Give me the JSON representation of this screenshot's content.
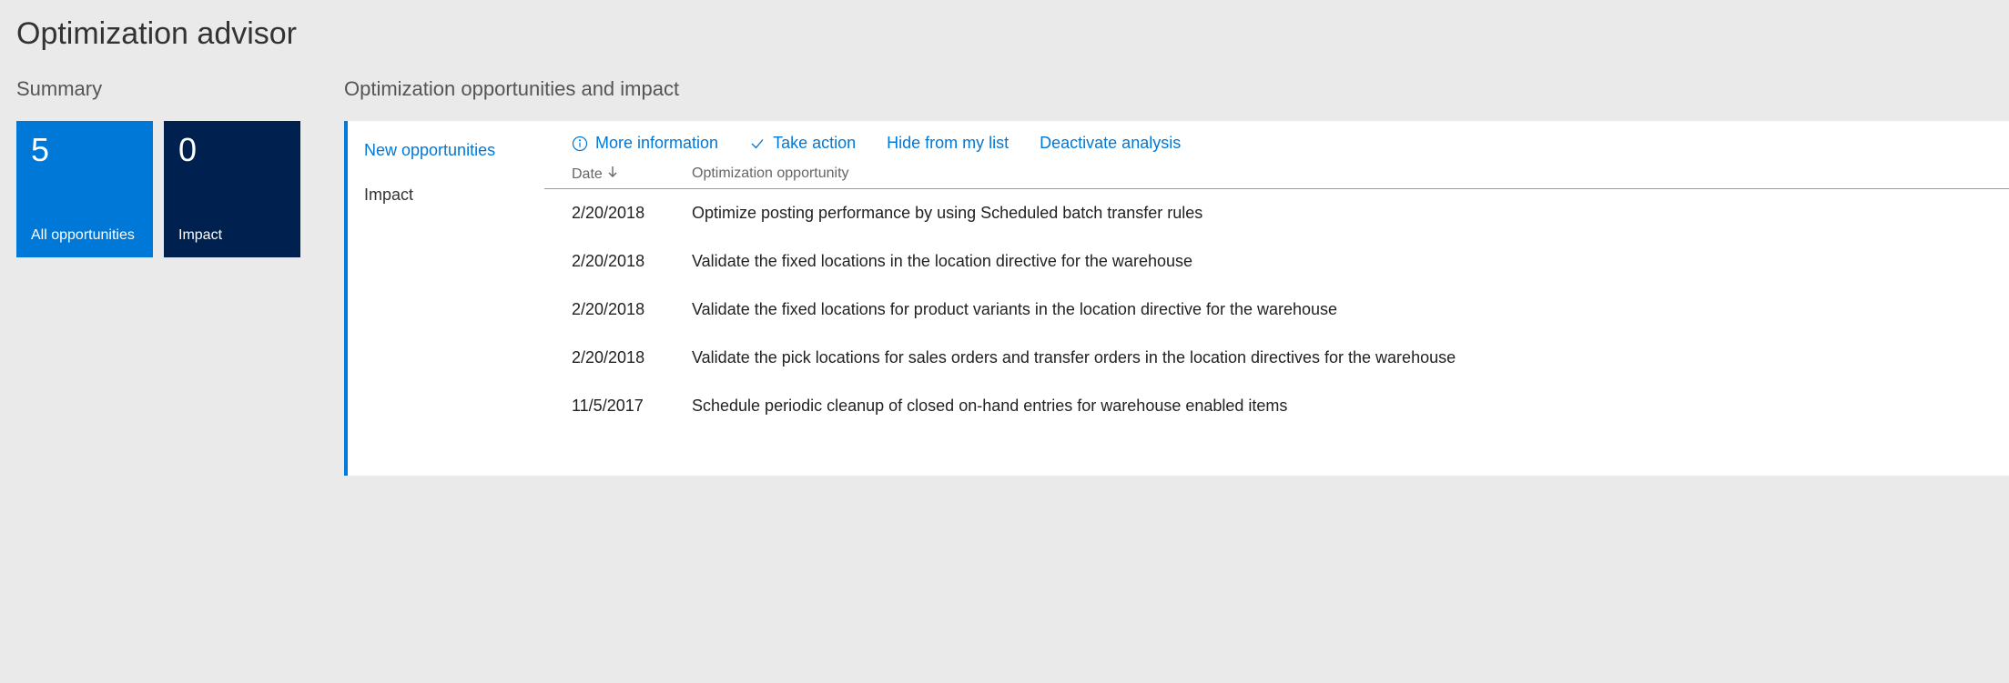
{
  "header": {
    "title": "Optimization advisor"
  },
  "summary": {
    "heading": "Summary",
    "tiles": [
      {
        "count": "5",
        "label": "All opportunities"
      },
      {
        "count": "0",
        "label": "Impact"
      }
    ]
  },
  "main": {
    "heading": "Optimization opportunities and impact",
    "tabs": [
      {
        "label": "New opportunities",
        "active": true
      },
      {
        "label": "Impact",
        "active": false
      }
    ],
    "actions": {
      "more_info": "More information",
      "take_action": "Take action",
      "hide": "Hide from my list",
      "deactivate": "Deactivate analysis"
    },
    "columns": {
      "date": "Date",
      "opportunity": "Optimization opportunity"
    },
    "rows": [
      {
        "date": "2/20/2018",
        "opportunity": "Optimize posting performance by using Scheduled batch transfer rules"
      },
      {
        "date": "2/20/2018",
        "opportunity": "Validate the fixed locations in the location directive for the warehouse"
      },
      {
        "date": "2/20/2018",
        "opportunity": "Validate the fixed locations for product variants in the location directive for the warehouse"
      },
      {
        "date": "2/20/2018",
        "opportunity": "Validate the pick locations for sales orders and transfer orders in the location directives for the warehouse"
      },
      {
        "date": "11/5/2017",
        "opportunity": "Schedule periodic cleanup of closed on-hand entries for warehouse enabled items"
      }
    ]
  }
}
